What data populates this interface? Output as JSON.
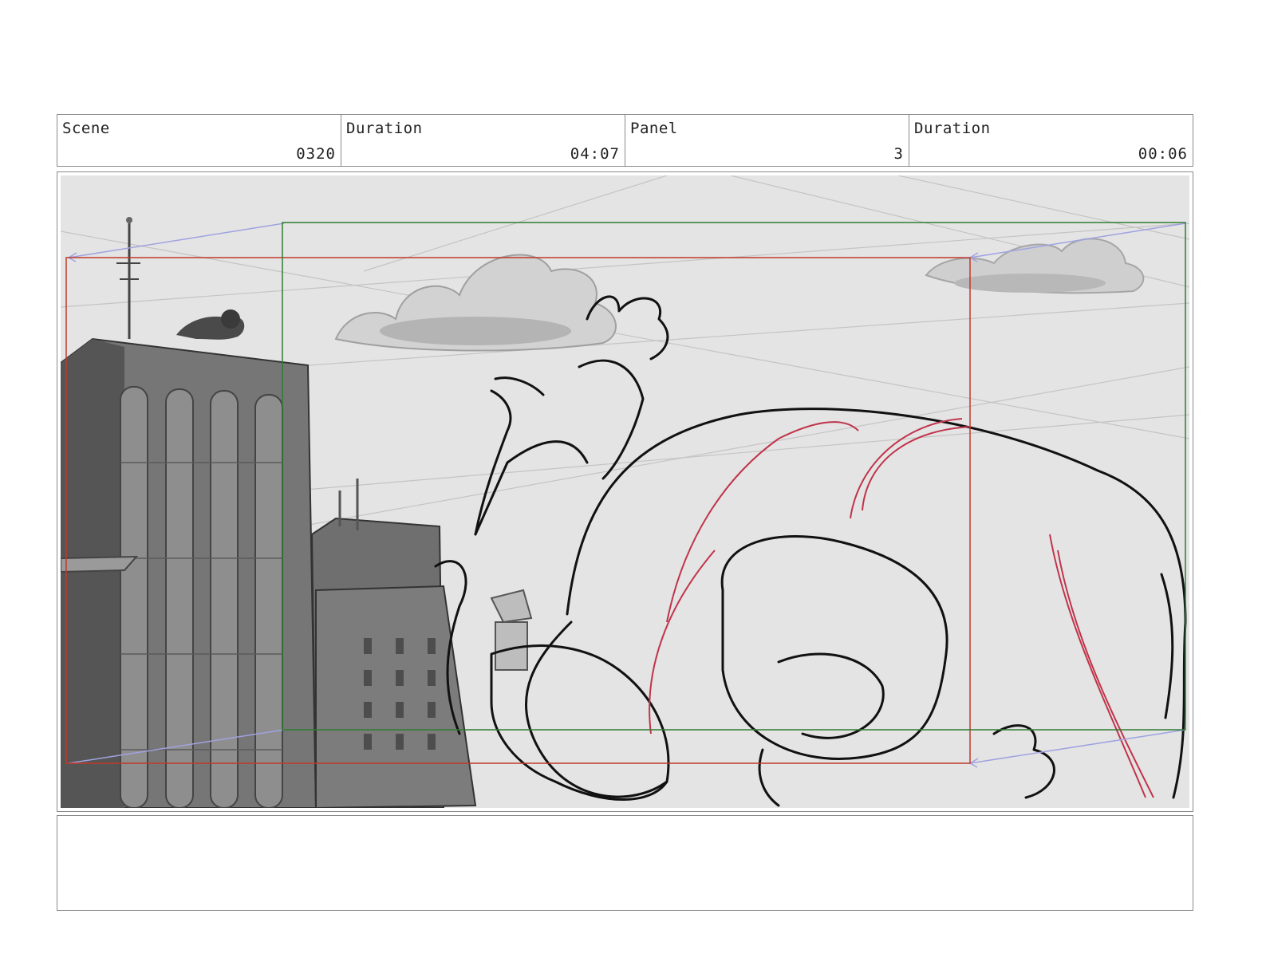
{
  "header": {
    "cells": [
      {
        "label": "Scene",
        "value": "0320"
      },
      {
        "label": "Duration",
        "value": "04:07"
      },
      {
        "label": "Panel",
        "value": "3"
      },
      {
        "label": "Duration",
        "value": "00:06"
      }
    ]
  },
  "panel": {
    "camera_colors": {
      "start_frame": "#c0392b",
      "end_frame": "#2e7d32",
      "move_arrows": "#9fa3e0"
    }
  },
  "notes": {
    "text": ""
  }
}
